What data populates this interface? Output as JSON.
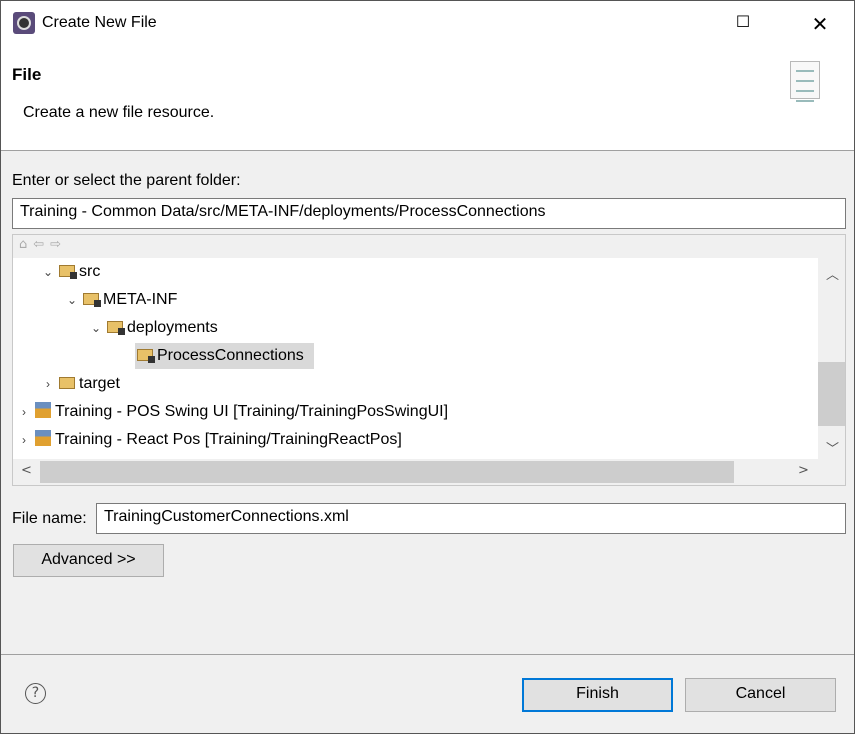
{
  "window": {
    "title": "Create New File",
    "minimize": "—",
    "maximize": "☐",
    "close": "✕"
  },
  "header": {
    "title": "File",
    "description": "Create a new file resource."
  },
  "parent": {
    "label": "Enter or select the parent folder:",
    "value": "Training - Common Data/src/META-INF/deployments/ProcessConnections"
  },
  "toolbar": {
    "home": "⌂",
    "back": "⇦",
    "forward": "⇨"
  },
  "tree": [
    {
      "label": "src",
      "expanded": true
    },
    {
      "label": "META-INF",
      "expanded": true
    },
    {
      "label": "deployments",
      "expanded": true
    },
    {
      "label": "ProcessConnections",
      "selected": true
    },
    {
      "label": "target",
      "expanded": false
    },
    {
      "label": "Training - POS Swing UI [Training/TrainingPosSwingUI]",
      "expanded": false
    },
    {
      "label": "Training - React Pos [Training/TrainingReactPos]",
      "expanded": false
    }
  ],
  "filename": {
    "label": "File name:",
    "value": "TrainingCustomerConnections.xml"
  },
  "buttons": {
    "advanced": "Advanced >>",
    "finish": "Finish",
    "cancel": "Cancel",
    "help": "?"
  }
}
